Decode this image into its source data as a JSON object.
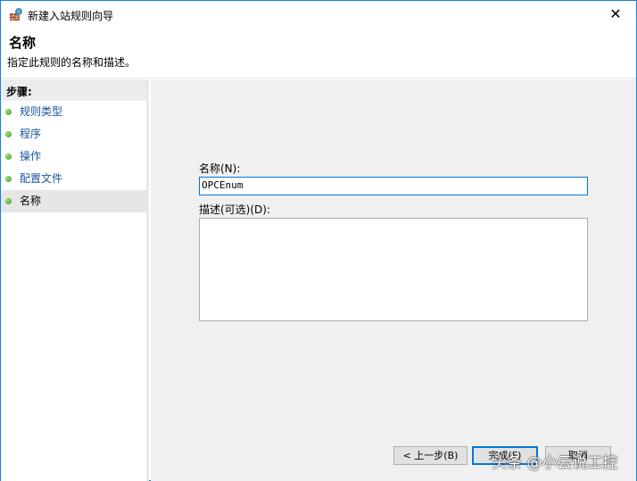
{
  "window": {
    "title": "新建入站规则向导",
    "close": "✕"
  },
  "header": {
    "title": "名称",
    "subtitle": "指定此规则的名称和描述。"
  },
  "steps": {
    "heading": "步骤:",
    "items": [
      {
        "label": "规则类型"
      },
      {
        "label": "程序"
      },
      {
        "label": "操作"
      },
      {
        "label": "配置文件"
      },
      {
        "label": "名称"
      }
    ]
  },
  "form": {
    "name_label": "名称(N):",
    "name_value": "OPCEnum",
    "desc_label": "描述(可选)(D):",
    "desc_value": ""
  },
  "buttons": {
    "back": "< 上一步(B)",
    "finish": "完成(F)",
    "cancel": "取消"
  },
  "watermark": "头条 @小云说工控"
}
